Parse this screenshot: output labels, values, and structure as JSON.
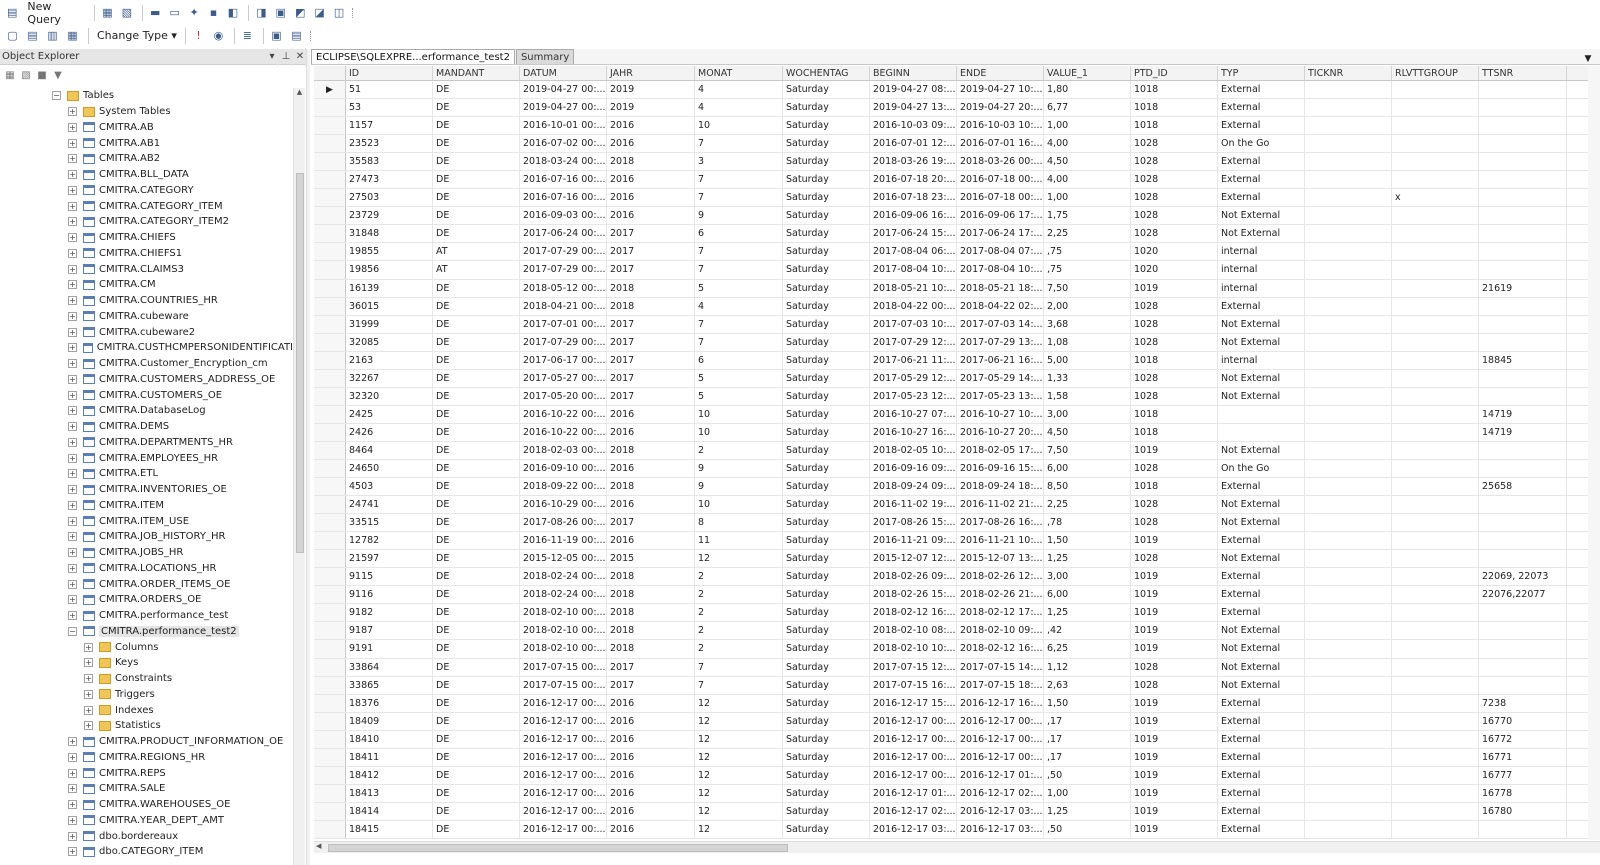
{
  "toolbar1": {
    "new_query_label": "New Query"
  },
  "toolbar2": {
    "change_type_label": "Change Type ▾"
  },
  "object_explorer": {
    "title": "Object Explorer",
    "pin_icon": "pin-icon",
    "close_icon": "close-icon",
    "tree": [
      {
        "label": "Tables",
        "level": 0,
        "exp": "−",
        "icon": "folder"
      },
      {
        "label": "System Tables",
        "level": 1,
        "exp": "+",
        "icon": "folder"
      },
      {
        "label": "CMITRA.AB",
        "level": 1,
        "exp": "+",
        "icon": "table"
      },
      {
        "label": "CMITRA.AB1",
        "level": 1,
        "exp": "+",
        "icon": "table"
      },
      {
        "label": "CMITRA.AB2",
        "level": 1,
        "exp": "+",
        "icon": "table"
      },
      {
        "label": "CMITRA.BLL_DATA",
        "level": 1,
        "exp": "+",
        "icon": "table"
      },
      {
        "label": "CMITRA.CATEGORY",
        "level": 1,
        "exp": "+",
        "icon": "table"
      },
      {
        "label": "CMITRA.CATEGORY_ITEM",
        "level": 1,
        "exp": "+",
        "icon": "table"
      },
      {
        "label": "CMITRA.CATEGORY_ITEM2",
        "level": 1,
        "exp": "+",
        "icon": "table"
      },
      {
        "label": "CMITRA.CHIEFS",
        "level": 1,
        "exp": "+",
        "icon": "table"
      },
      {
        "label": "CMITRA.CHIEFS1",
        "level": 1,
        "exp": "+",
        "icon": "table"
      },
      {
        "label": "CMITRA.CLAIMS3",
        "level": 1,
        "exp": "+",
        "icon": "table"
      },
      {
        "label": "CMITRA.CM",
        "level": 1,
        "exp": "+",
        "icon": "table"
      },
      {
        "label": "CMITRA.COUNTRIES_HR",
        "level": 1,
        "exp": "+",
        "icon": "table"
      },
      {
        "label": "CMITRA.cubeware",
        "level": 1,
        "exp": "+",
        "icon": "table"
      },
      {
        "label": "CMITRA.cubeware2",
        "level": 1,
        "exp": "+",
        "icon": "table"
      },
      {
        "label": "CMITRA.CUSTHCMPERSONIDENTIFICATI",
        "level": 1,
        "exp": "+",
        "icon": "table"
      },
      {
        "label": "CMITRA.Customer_Encryption_cm",
        "level": 1,
        "exp": "+",
        "icon": "table"
      },
      {
        "label": "CMITRA.CUSTOMERS_ADDRESS_OE",
        "level": 1,
        "exp": "+",
        "icon": "table"
      },
      {
        "label": "CMITRA.CUSTOMERS_OE",
        "level": 1,
        "exp": "+",
        "icon": "table"
      },
      {
        "label": "CMITRA.DatabaseLog",
        "level": 1,
        "exp": "+",
        "icon": "table"
      },
      {
        "label": "CMITRA.DEMS",
        "level": 1,
        "exp": "+",
        "icon": "table"
      },
      {
        "label": "CMITRA.DEPARTMENTS_HR",
        "level": 1,
        "exp": "+",
        "icon": "table"
      },
      {
        "label": "CMITRA.EMPLOYEES_HR",
        "level": 1,
        "exp": "+",
        "icon": "table"
      },
      {
        "label": "CMITRA.ETL",
        "level": 1,
        "exp": "+",
        "icon": "table"
      },
      {
        "label": "CMITRA.INVENTORIES_OE",
        "level": 1,
        "exp": "+",
        "icon": "table"
      },
      {
        "label": "CMITRA.ITEM",
        "level": 1,
        "exp": "+",
        "icon": "table"
      },
      {
        "label": "CMITRA.ITEM_USE",
        "level": 1,
        "exp": "+",
        "icon": "table"
      },
      {
        "label": "CMITRA.JOB_HISTORY_HR",
        "level": 1,
        "exp": "+",
        "icon": "table"
      },
      {
        "label": "CMITRA.JOBS_HR",
        "level": 1,
        "exp": "+",
        "icon": "table"
      },
      {
        "label": "CMITRA.LOCATIONS_HR",
        "level": 1,
        "exp": "+",
        "icon": "table"
      },
      {
        "label": "CMITRA.ORDER_ITEMS_OE",
        "level": 1,
        "exp": "+",
        "icon": "table"
      },
      {
        "label": "CMITRA.ORDERS_OE",
        "level": 1,
        "exp": "+",
        "icon": "table"
      },
      {
        "label": "CMITRA.performance_test",
        "level": 1,
        "exp": "+",
        "icon": "table"
      },
      {
        "label": "CMITRA.performance_test2",
        "level": 1,
        "exp": "−",
        "icon": "table",
        "selected": true
      },
      {
        "label": "Columns",
        "level": 2,
        "exp": "+",
        "icon": "folder"
      },
      {
        "label": "Keys",
        "level": 2,
        "exp": "+",
        "icon": "folder"
      },
      {
        "label": "Constraints",
        "level": 2,
        "exp": "+",
        "icon": "folder"
      },
      {
        "label": "Triggers",
        "level": 2,
        "exp": "+",
        "icon": "folder"
      },
      {
        "label": "Indexes",
        "level": 2,
        "exp": "+",
        "icon": "folder"
      },
      {
        "label": "Statistics",
        "level": 2,
        "exp": "+",
        "icon": "folder"
      },
      {
        "label": "CMITRA.PRODUCT_INFORMATION_OE",
        "level": 1,
        "exp": "+",
        "icon": "table"
      },
      {
        "label": "CMITRA.REGIONS_HR",
        "level": 1,
        "exp": "+",
        "icon": "table"
      },
      {
        "label": "CMITRA.REPS",
        "level": 1,
        "exp": "+",
        "icon": "table"
      },
      {
        "label": "CMITRA.SALE",
        "level": 1,
        "exp": "+",
        "icon": "table"
      },
      {
        "label": "CMITRA.WAREHOUSES_OE",
        "level": 1,
        "exp": "+",
        "icon": "table"
      },
      {
        "label": "CMITRA.YEAR_DEPT_AMT",
        "level": 1,
        "exp": "+",
        "icon": "table"
      },
      {
        "label": "dbo.bordereaux",
        "level": 1,
        "exp": "+",
        "icon": "table"
      },
      {
        "label": "dbo.CATEGORY_ITEM",
        "level": 1,
        "exp": "+",
        "icon": "table"
      }
    ]
  },
  "tabs": [
    {
      "label": "ECLIPSE\\SQLEXPRE...erformance_test2",
      "active": true
    },
    {
      "label": "Summary",
      "active": false
    }
  ],
  "grid": {
    "columns": [
      "ID",
      "MANDANT",
      "DATUM",
      "JAHR",
      "MONAT",
      "WOCHENTAG",
      "BEGINN",
      "ENDE",
      "VALUE_1",
      "PTD_ID",
      "TYP",
      "TICKNR",
      "RLVTTGROUP",
      "TTSNR"
    ],
    "rows": [
      [
        "51",
        "DE",
        "2019-04-27 00:...",
        "2019",
        "4",
        "Saturday",
        "2019-04-27 08:...",
        "2019-04-27 10:...",
        "1,80",
        "1018",
        "External",
        "",
        "",
        ""
      ],
      [
        "53",
        "DE",
        "2019-04-27 00:...",
        "2019",
        "4",
        "Saturday",
        "2019-04-27 13:...",
        "2019-04-27 20:...",
        "6,77",
        "1018",
        "External",
        "",
        "",
        ""
      ],
      [
        "1157",
        "DE",
        "2016-10-01 00:...",
        "2016",
        "10",
        "Saturday",
        "2016-10-03 09:...",
        "2016-10-03 10:...",
        "1,00",
        "1018",
        "External",
        "",
        "",
        ""
      ],
      [
        "23523",
        "DE",
        "2016-07-02 00:...",
        "2016",
        "7",
        "Saturday",
        "2016-07-01 12:...",
        "2016-07-01 16:...",
        "4,00",
        "1028",
        "On the Go",
        "",
        "",
        ""
      ],
      [
        "35583",
        "DE",
        "2018-03-24 00:...",
        "2018",
        "3",
        "Saturday",
        "2018-03-26 19:...",
        "2018-03-26 00:...",
        "4,50",
        "1028",
        "External",
        "",
        "",
        ""
      ],
      [
        "27473",
        "DE",
        "2016-07-16 00:...",
        "2016",
        "7",
        "Saturday",
        "2016-07-18 20:...",
        "2016-07-18 00:...",
        "4,00",
        "1028",
        "External",
        "",
        "",
        ""
      ],
      [
        "27503",
        "DE",
        "2016-07-16 00:...",
        "2016",
        "7",
        "Saturday",
        "2016-07-18 23:...",
        "2016-07-18 00:...",
        "1,00",
        "1028",
        "External",
        "",
        "x",
        ""
      ],
      [
        "23729",
        "DE",
        "2016-09-03 00:...",
        "2016",
        "9",
        "Saturday",
        "2016-09-06 16:...",
        "2016-09-06 17:...",
        "1,75",
        "1028",
        "Not External",
        "",
        "",
        ""
      ],
      [
        "31848",
        "DE",
        "2017-06-24 00:...",
        "2017",
        "6",
        "Saturday",
        "2017-06-24 15:...",
        "2017-06-24 17:...",
        "2,25",
        "1028",
        "Not External",
        "",
        "",
        ""
      ],
      [
        "19855",
        "AT",
        "2017-07-29 00:...",
        "2017",
        "7",
        "Saturday",
        "2017-08-04 06:...",
        "2017-08-04 07:...",
        ",75",
        "1020",
        "internal",
        "",
        "",
        ""
      ],
      [
        "19856",
        "AT",
        "2017-07-29 00:...",
        "2017",
        "7",
        "Saturday",
        "2017-08-04 10:...",
        "2017-08-04 10:...",
        ",75",
        "1020",
        "internal",
        "",
        "",
        ""
      ],
      [
        "16139",
        "DE",
        "2018-05-12 00:...",
        "2018",
        "5",
        "Saturday",
        "2018-05-21 10:...",
        "2018-05-21 18:...",
        "7,50",
        "1019",
        "internal",
        "",
        "",
        "21619"
      ],
      [
        "36015",
        "DE",
        "2018-04-21 00:...",
        "2018",
        "4",
        "Saturday",
        "2018-04-22 00:...",
        "2018-04-22 02:...",
        "2,00",
        "1028",
        "External",
        "",
        "",
        ""
      ],
      [
        "31999",
        "DE",
        "2017-07-01 00:...",
        "2017",
        "7",
        "Saturday",
        "2017-07-03 10:...",
        "2017-07-03 14:...",
        "3,68",
        "1028",
        "Not External",
        "",
        "",
        ""
      ],
      [
        "32085",
        "DE",
        "2017-07-29 00:...",
        "2017",
        "7",
        "Saturday",
        "2017-07-29 12:...",
        "2017-07-29 13:...",
        "1,08",
        "1028",
        "Not External",
        "",
        "",
        ""
      ],
      [
        "2163",
        "DE",
        "2017-06-17 00:...",
        "2017",
        "6",
        "Saturday",
        "2017-06-21 11:...",
        "2017-06-21 16:...",
        "5,00",
        "1018",
        "internal",
        "",
        "",
        "18845"
      ],
      [
        "32267",
        "DE",
        "2017-05-27 00:...",
        "2017",
        "5",
        "Saturday",
        "2017-05-29 12:...",
        "2017-05-29 14:...",
        "1,33",
        "1028",
        "Not External",
        "",
        "",
        ""
      ],
      [
        "32320",
        "DE",
        "2017-05-20 00:...",
        "2017",
        "5",
        "Saturday",
        "2017-05-23 12:...",
        "2017-05-23 13:...",
        "1,58",
        "1028",
        "Not External",
        "",
        "",
        ""
      ],
      [
        "2425",
        "DE",
        "2016-10-22 00:...",
        "2016",
        "10",
        "Saturday",
        "2016-10-27 07:...",
        "2016-10-27 10:...",
        "3,00",
        "1018",
        "",
        "",
        "",
        "14719"
      ],
      [
        "2426",
        "DE",
        "2016-10-22 00:...",
        "2016",
        "10",
        "Saturday",
        "2016-10-27 16:...",
        "2016-10-27 20:...",
        "4,50",
        "1018",
        "",
        "",
        "",
        "14719"
      ],
      [
        "8464",
        "DE",
        "2018-02-03 00:...",
        "2018",
        "2",
        "Saturday",
        "2018-02-05 10:...",
        "2018-02-05 17:...",
        "7,50",
        "1019",
        "Not External",
        "",
        "",
        ""
      ],
      [
        "24650",
        "DE",
        "2016-09-10 00:...",
        "2016",
        "9",
        "Saturday",
        "2016-09-16 09:...",
        "2016-09-16 15:...",
        "6,00",
        "1028",
        "On the Go",
        "",
        "",
        ""
      ],
      [
        "4503",
        "DE",
        "2018-09-22 00:...",
        "2018",
        "9",
        "Saturday",
        "2018-09-24 09:...",
        "2018-09-24 18:...",
        "8,50",
        "1018",
        "External",
        "",
        "",
        "25658"
      ],
      [
        "24741",
        "DE",
        "2016-10-29 00:...",
        "2016",
        "10",
        "Saturday",
        "2016-11-02 19:...",
        "2016-11-02 21:...",
        "2,25",
        "1028",
        "Not External",
        "",
        "",
        ""
      ],
      [
        "33515",
        "DE",
        "2017-08-26 00:...",
        "2017",
        "8",
        "Saturday",
        "2017-08-26 15:...",
        "2017-08-26 16:...",
        ",78",
        "1028",
        "Not External",
        "",
        "",
        ""
      ],
      [
        "12782",
        "DE",
        "2016-11-19 00:...",
        "2016",
        "11",
        "Saturday",
        "2016-11-21 09:...",
        "2016-11-21 10:...",
        "1,50",
        "1019",
        "External",
        "",
        "",
        ""
      ],
      [
        "21597",
        "DE",
        "2015-12-05 00:...",
        "2015",
        "12",
        "Saturday",
        "2015-12-07 12:...",
        "2015-12-07 13:...",
        "1,25",
        "1028",
        "Not External",
        "",
        "",
        ""
      ],
      [
        "9115",
        "DE",
        "2018-02-24 00:...",
        "2018",
        "2",
        "Saturday",
        "2018-02-26 09:...",
        "2018-02-26 12:...",
        "3,00",
        "1019",
        "External",
        "",
        "",
        "22069, 22073"
      ],
      [
        "9116",
        "DE",
        "2018-02-24 00:...",
        "2018",
        "2",
        "Saturday",
        "2018-02-26 15:...",
        "2018-02-26 21:...",
        "6,00",
        "1019",
        "External",
        "",
        "",
        "22076,22077"
      ],
      [
        "9182",
        "DE",
        "2018-02-10 00:...",
        "2018",
        "2",
        "Saturday",
        "2018-02-12 16:...",
        "2018-02-12 17:...",
        "1,25",
        "1019",
        "External",
        "",
        "",
        ""
      ],
      [
        "9187",
        "DE",
        "2018-02-10 00:...",
        "2018",
        "2",
        "Saturday",
        "2018-02-10 08:...",
        "2018-02-10 09:...",
        ",42",
        "1019",
        "Not External",
        "",
        "",
        ""
      ],
      [
        "9191",
        "DE",
        "2018-02-10 00:...",
        "2018",
        "2",
        "Saturday",
        "2018-02-10 10:...",
        "2018-02-12 16:...",
        "6,25",
        "1019",
        "Not External",
        "",
        "",
        ""
      ],
      [
        "33864",
        "DE",
        "2017-07-15 00:...",
        "2017",
        "7",
        "Saturday",
        "2017-07-15 12:...",
        "2017-07-15 14:...",
        "1,12",
        "1028",
        "Not External",
        "",
        "",
        ""
      ],
      [
        "33865",
        "DE",
        "2017-07-15 00:...",
        "2017",
        "7",
        "Saturday",
        "2017-07-15 16:...",
        "2017-07-15 18:...",
        "2,63",
        "1028",
        "Not External",
        "",
        "",
        ""
      ],
      [
        "18376",
        "DE",
        "2016-12-17 00:...",
        "2016",
        "12",
        "Saturday",
        "2016-12-17 15:...",
        "2016-12-17 16:...",
        "1,50",
        "1019",
        "External",
        "",
        "",
        "7238"
      ],
      [
        "18409",
        "DE",
        "2016-12-17 00:...",
        "2016",
        "12",
        "Saturday",
        "2016-12-17 00:...",
        "2016-12-17 00:...",
        ",17",
        "1019",
        "External",
        "",
        "",
        "16770"
      ],
      [
        "18410",
        "DE",
        "2016-12-17 00:...",
        "2016",
        "12",
        "Saturday",
        "2016-12-17 00:...",
        "2016-12-17 00:...",
        ",17",
        "1019",
        "External",
        "",
        "",
        "16772"
      ],
      [
        "18411",
        "DE",
        "2016-12-17 00:...",
        "2016",
        "12",
        "Saturday",
        "2016-12-17 00:...",
        "2016-12-17 00:...",
        ",17",
        "1019",
        "External",
        "",
        "",
        "16771"
      ],
      [
        "18412",
        "DE",
        "2016-12-17 00:...",
        "2016",
        "12",
        "Saturday",
        "2016-12-17 00:...",
        "2016-12-17 01:...",
        ",50",
        "1019",
        "External",
        "",
        "",
        "16777"
      ],
      [
        "18413",
        "DE",
        "2016-12-17 00:...",
        "2016",
        "12",
        "Saturday",
        "2016-12-17 01:...",
        "2016-12-17 02:...",
        "1,00",
        "1019",
        "External",
        "",
        "",
        "16778"
      ],
      [
        "18414",
        "DE",
        "2016-12-17 00:...",
        "2016",
        "12",
        "Saturday",
        "2016-12-17 02:...",
        "2016-12-17 03:...",
        "1,25",
        "1019",
        "External",
        "",
        "",
        "16780"
      ],
      [
        "18415",
        "DE",
        "2016-12-17 00:...",
        "2016",
        "12",
        "Saturday",
        "2016-12-17 03:...",
        "2016-12-17 03:...",
        ",50",
        "1019",
        "External",
        "",
        "",
        ""
      ]
    ]
  }
}
